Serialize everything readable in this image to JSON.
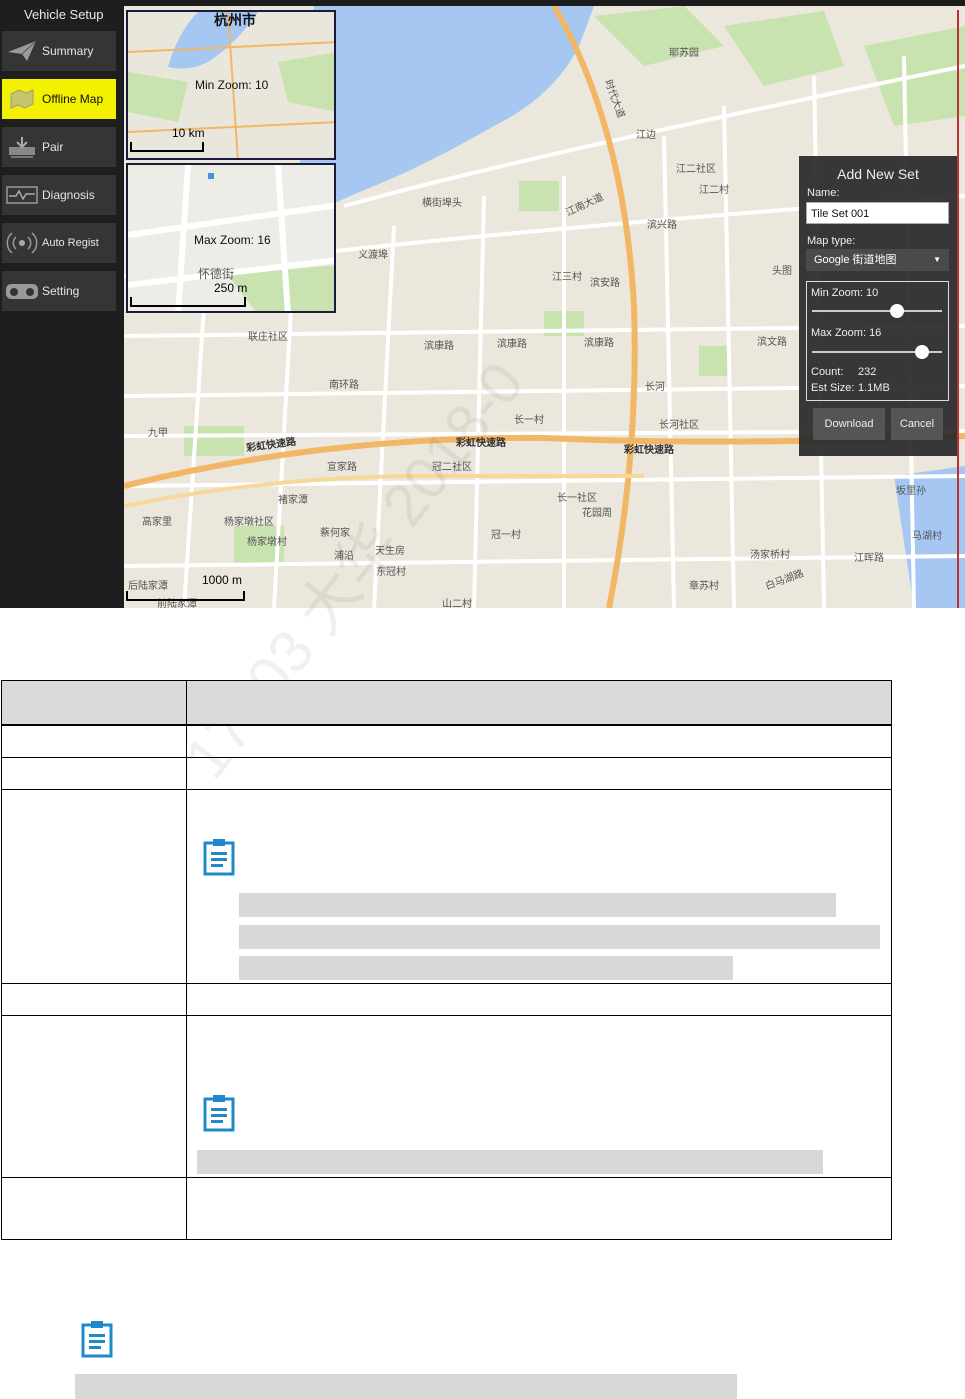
{
  "app": {
    "sidebar_title": "Vehicle Setup",
    "nav": [
      {
        "label": "Summary",
        "icon": "paper-plane-icon"
      },
      {
        "label": "Offline Map",
        "icon": "map-icon",
        "active": true
      },
      {
        "label": "Pair",
        "icon": "pair-icon"
      },
      {
        "label": "Diagnosis",
        "icon": "diagnosis-icon"
      },
      {
        "label": "Auto Regist",
        "icon": "broadcast-icon"
      },
      {
        "label": "Setting",
        "icon": "gamepad-icon"
      }
    ],
    "accent_color": "#f4f100"
  },
  "map": {
    "inset_min": {
      "title": "杭州市",
      "zoom_label": "Min Zoom: 10",
      "scale": "10 km"
    },
    "inset_max": {
      "zoom_label": "Max Zoom: 16",
      "place": "怀德街",
      "scale": "250 m"
    },
    "scale_main": "1000 m",
    "labels": {
      "l1": "时代大道",
      "l2": "江南大道",
      "l3": "彩虹快速路",
      "l4": "彩虹快速路",
      "l5": "彩虹快速路",
      "l6": "江二社区",
      "l7": "江二村",
      "l8": "滨兴路",
      "l9": "江三村",
      "l10": "滨安路",
      "l11": "长一村",
      "l12": "长河社区",
      "l13": "长一社区",
      "l14": "花园周",
      "l15": "冠二社区",
      "l16": "冠一村",
      "l17": "宣家路",
      "l18": "高家里",
      "l19": "杨家墩社区",
      "l20": "杨家墩村",
      "l21": "马湖村",
      "l22": "汤家桥村",
      "l23": "江晖路",
      "l24": "横街埠头",
      "l25": "义渡埠",
      "l26": "联庄社区",
      "l27": "南环路",
      "l28": "滨康路",
      "l29": "滨康路",
      "l30": "滨康路",
      "l31": "九甲",
      "l32": "褚家潭",
      "l33": "蔡何家",
      "l34": "浦沿",
      "l35": "天生房",
      "l36": "东冠村",
      "l37": "头图",
      "l38": "耶苏园",
      "l39": "江边",
      "l40": "坂里孙",
      "l41": "后陆家潭",
      "l42": "前陆家潭",
      "l43": "山二村",
      "l44": "章苏村",
      "l45": "白马湖路",
      "l46": "长河",
      "l47": "滨文路"
    }
  },
  "panel": {
    "title": "Add New Set",
    "name_label": "Name:",
    "name_value": "Tile Set 001",
    "map_type_label": "Map type:",
    "map_type_value": "Google 街道地图",
    "min_zoom": "Min Zoom: 10",
    "max_zoom": "Max Zoom: 16",
    "min_zoom_value": 10,
    "max_zoom_value": 16,
    "count_label": "Count:",
    "count_value": "232",
    "size_label": "Est Size:",
    "size_value": "1.1MB",
    "download": "Download",
    "cancel": "Cancel"
  },
  "watermark": "17803  大华  2018-0"
}
